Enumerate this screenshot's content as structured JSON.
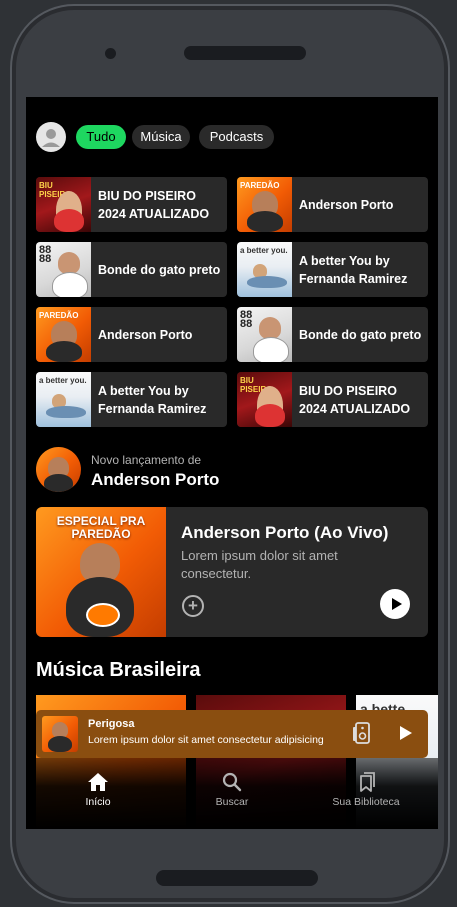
{
  "filters": {
    "all": "Tudo",
    "music": "Música",
    "podcasts": "Podcasts"
  },
  "shortcuts": [
    {
      "label": "BIU DO PISEIRO 2024 ATUALIZADO",
      "art": "biu"
    },
    {
      "label": "Anderson Porto",
      "art": "orange"
    },
    {
      "label": "Bonde do gato preto",
      "art": "gato"
    },
    {
      "label": "A better You by Fernanda Ramirez",
      "art": "better"
    },
    {
      "label": "Anderson Porto",
      "art": "orange"
    },
    {
      "label": "Bonde do gato preto",
      "art": "gato"
    },
    {
      "label": "A better You by Fernanda Ramirez",
      "art": "better"
    },
    {
      "label": "BIU DO PISEIRO 2024 ATUALIZADO",
      "art": "biu"
    }
  ],
  "new_release": {
    "subtitle": "Novo lançamento de",
    "artist": "Anderson Porto",
    "card_title": "Anderson Porto (Ao Vivo)",
    "card_description": "Lorem ipsum dolor sit amet consectetur.",
    "cover_text": "ESPECIAL PRA PAREDÃO"
  },
  "section": {
    "title": "Música Brasileira"
  },
  "mini_player": {
    "song": "Perigosa",
    "artist": "Lorem ipsum dolor sit amet consectetur adipisicing"
  },
  "nav": {
    "home": "Início",
    "search": "Buscar",
    "library": "Sua Biblioteca"
  },
  "colors": {
    "accent": "#1ed760",
    "background": "#000000",
    "tile": "#292929",
    "mini_player": "#8a4e10"
  }
}
